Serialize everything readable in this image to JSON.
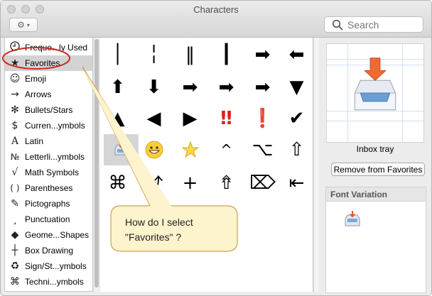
{
  "window": {
    "title": "Characters"
  },
  "toolbar": {
    "search_placeholder": "Search"
  },
  "sidebar": {
    "items": [
      {
        "icon": "🕘",
        "label": "Freque...ly Used"
      },
      {
        "icon": "★",
        "label": "Favorites"
      },
      {
        "icon": "☺",
        "label": "Emoji"
      },
      {
        "icon": "→",
        "label": "Arrows"
      },
      {
        "icon": "✻",
        "label": "Bullets/Stars"
      },
      {
        "icon": "$",
        "label": "Curren...ymbols"
      },
      {
        "icon": "A",
        "label": "Latin"
      },
      {
        "icon": "№",
        "label": "Letterli...ymbols"
      },
      {
        "icon": "√",
        "label": "Math Symbols"
      },
      {
        "icon": "( )",
        "label": "Parentheses"
      },
      {
        "icon": "✎",
        "label": "Pictographs"
      },
      {
        "icon": "¸",
        "label": "Punctuation"
      },
      {
        "icon": "◆",
        "label": "Geome...Shapes"
      },
      {
        "icon": "┼",
        "label": "Box Drawing"
      },
      {
        "icon": "♻",
        "label": "Sign/St...ymbols"
      },
      {
        "icon": "⌘",
        "label": "Techni...ymbols"
      }
    ]
  },
  "grid": {
    "cells": [
      "│",
      "╎",
      "‖",
      "┃",
      "➡",
      "⬅",
      "⬆",
      "⬇",
      "➡",
      "➡",
      "➡",
      "▼",
      "▲",
      "◀",
      "▶",
      "‼",
      "❗",
      "✔",
      "📥",
      "😀",
      "⭐",
      "^",
      "⌥",
      "⇧",
      "⌘",
      "⤴",
      "+",
      "⇮",
      "⌦",
      "⇤"
    ]
  },
  "preview": {
    "character_name": "Inbox tray",
    "remove_label": "Remove from Favorites",
    "font_variation_label": "Font Variation"
  },
  "annotation": {
    "text": "How do I select \"Favorites\" ?"
  },
  "colors": {
    "highlight_ellipse": "#cc2a1f",
    "callout_fill": "#fdf3cd",
    "callout_border": "#c9a258"
  }
}
